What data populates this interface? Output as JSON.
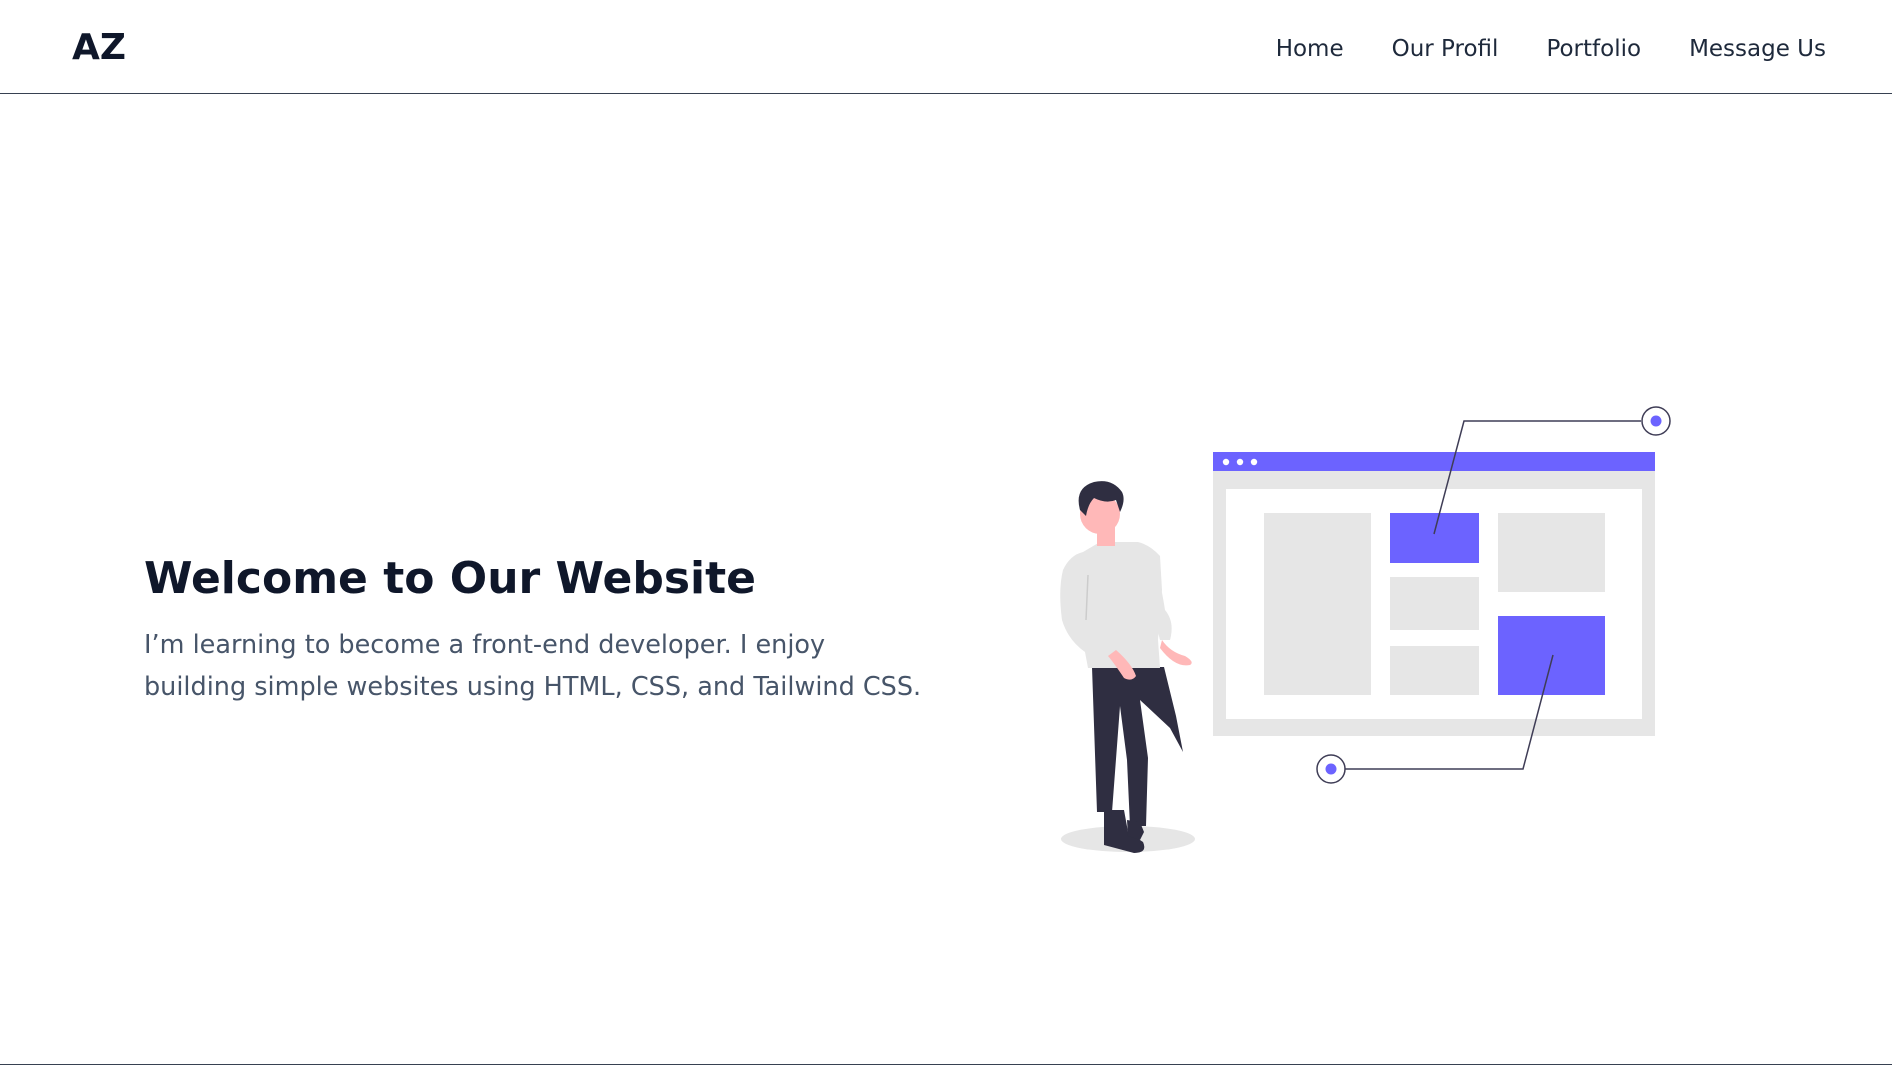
{
  "navbar": {
    "logo": "AZ",
    "items": [
      {
        "label": "Home"
      },
      {
        "label": "Our Profil"
      },
      {
        "label": "Portfolio"
      },
      {
        "label": "Message Us"
      }
    ]
  },
  "hero": {
    "title": "Welcome to Our Website",
    "description": "I’m learning to become a front-end developer. I enjoy building simple websites using HTML, CSS, and Tailwind CSS."
  },
  "illustration": {
    "icon": "web-developer-illustration",
    "colors": {
      "accent": "#6c63ff",
      "panel_gray": "#e6e6e6",
      "dark": "#2f2e41",
      "skin": "#ffb8b8",
      "shirt": "#e6e6e6",
      "line": "#3f3d56"
    }
  }
}
